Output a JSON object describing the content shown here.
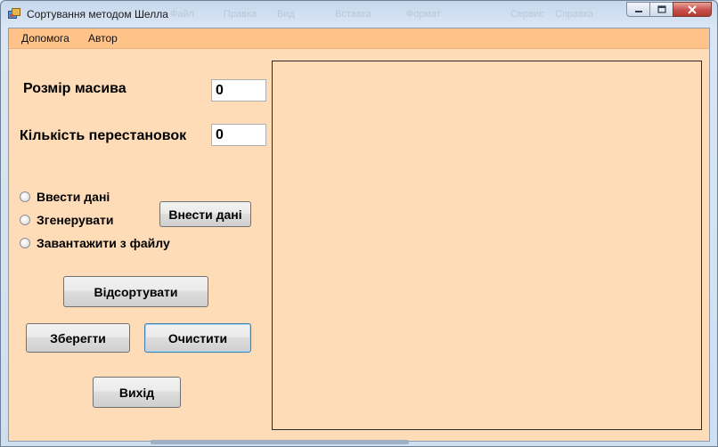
{
  "window": {
    "title": "Сортування методом Шелла",
    "ghost_titles": [
      "Файл",
      "Правка",
      "Вид",
      "Вставка",
      "Формат",
      "Сервис",
      "Справка"
    ],
    "colors": {
      "client_bg": "#ffdcb8",
      "menubar_bg": "#ffc38a",
      "close_button": "#c75050"
    }
  },
  "menu": {
    "items": [
      {
        "label": "Допомога"
      },
      {
        "label": "Автор"
      }
    ]
  },
  "form": {
    "array_size_label": "Розмір масива",
    "array_size_value": "0",
    "swaps_label": "Кількість перестановок",
    "swaps_value": "0",
    "input_mode": {
      "options": [
        {
          "label": "Ввести дані",
          "checked": false
        },
        {
          "label": "Згенерувати",
          "checked": false
        },
        {
          "label": "Завантажити з файлу",
          "checked": false
        }
      ]
    },
    "enter_data_button": "Внести дані",
    "sort_button": "Відсортувати",
    "save_button": "Зберегти",
    "clear_button": "Очистити",
    "exit_button": "Вихід"
  },
  "icons": {
    "app": "app-window-icon",
    "minimize": "minimize-icon",
    "maximize": "maximize-icon",
    "close": "close-icon"
  }
}
